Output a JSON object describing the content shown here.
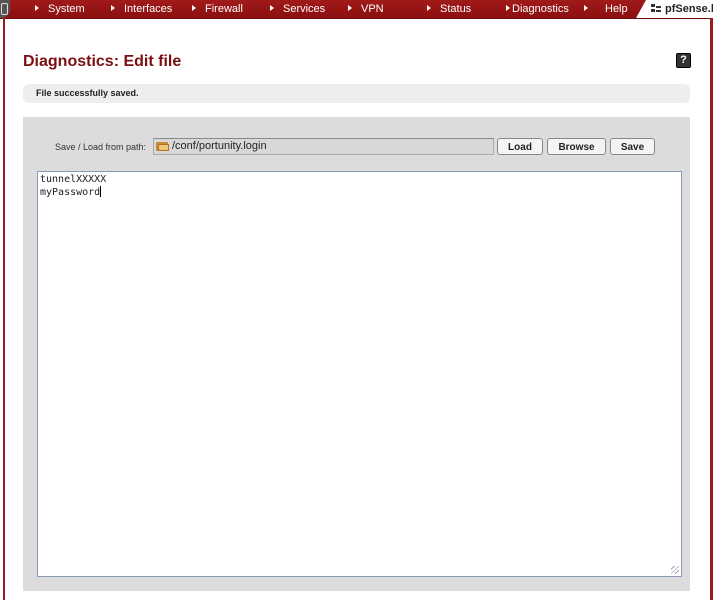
{
  "nav": {
    "items": [
      "System",
      "Interfaces",
      "Firewall",
      "Services",
      "VPN",
      "Status",
      "Diagnostics",
      "Help"
    ],
    "brand": "pfSense.lo"
  },
  "page": {
    "title": "Diagnostics: Edit file",
    "help_icon": "?"
  },
  "status": {
    "message": "File successfully saved."
  },
  "form": {
    "path_label": "Save / Load from path:",
    "path_value": "/conf/portunity.login",
    "load_label": "Load",
    "browse_label": "Browse",
    "save_label": "Save"
  },
  "editor": {
    "lines": [
      "tunnelXXXXX",
      "myPassword"
    ]
  },
  "colors": {
    "nav_bg": "#a11a1a",
    "title": "#7a1010",
    "panel_bg": "#dcdcdc"
  },
  "icons": [
    "help-icon",
    "folder-icon",
    "pfsense-logo-icon",
    "resize-grip-icon"
  ]
}
